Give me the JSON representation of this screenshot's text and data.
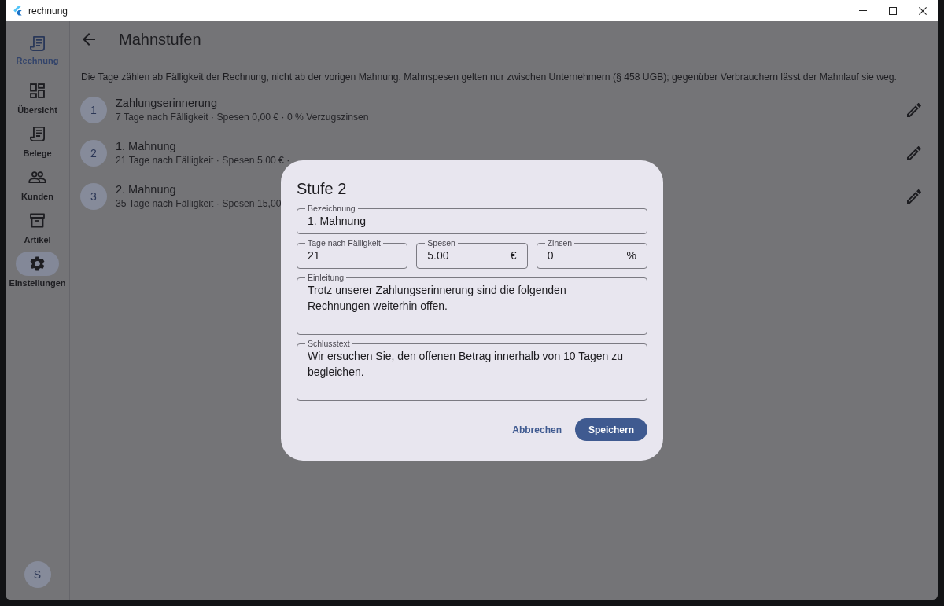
{
  "window": {
    "title": "rechnung"
  },
  "nav_rail": {
    "brand": "Rechnung",
    "items": [
      {
        "label": "Übersicht",
        "kind": "overview",
        "selected": false
      },
      {
        "label": "Belege",
        "kind": "documents",
        "selected": false
      },
      {
        "label": "Kunden",
        "kind": "customers",
        "selected": false
      },
      {
        "label": "Artikel",
        "kind": "articles",
        "selected": false
      },
      {
        "label": "Einstellungen",
        "kind": "settings",
        "selected": true
      }
    ],
    "avatar": "S"
  },
  "page": {
    "title": "Mahnstufen",
    "note": "Die Tage zählen ab Fälligkeit der Rechnung, nicht ab der vorigen Mahnung. Mahnspesen gelten nur zwischen Unternehmern (§ 458 UGB); gegenüber Verbrauchern lässt der Mahnlauf sie weg.",
    "levels": [
      {
        "number": "1",
        "title": "Zahlungserinnerung",
        "detail": "7 Tage nach Fälligkeit · Spesen 0,00 € · 0 % Verzugszinsen"
      },
      {
        "number": "2",
        "title": "1. Mahnung",
        "detail": "21 Tage nach Fälligkeit · Spesen 5,00 € ·"
      },
      {
        "number": "3",
        "title": "2. Mahnung",
        "detail": "35 Tage nach Fälligkeit · Spesen 15,00"
      }
    ]
  },
  "dialog": {
    "title": "Stufe 2",
    "rows": [
      [
        {
          "label": "Bezeichnung",
          "value": "1. Mahnung",
          "kind": "single"
        }
      ],
      [
        {
          "label": "Tage nach Fälligkeit",
          "value": "21",
          "kind": "single"
        },
        {
          "label": "Spesen",
          "value": "5.00",
          "suffix": "€",
          "kind": "single"
        },
        {
          "label": "Zinsen",
          "value": "0",
          "suffix": "%",
          "kind": "single"
        }
      ],
      [
        {
          "label": "Einleitung",
          "value": "Trotz unserer Zahlungserinnerung sind die folgenden Rechnungen weiterhin offen.",
          "kind": "multiline"
        }
      ],
      [
        {
          "label": "Schlusstext",
          "value": "Wir ersuchen Sie, den offenen Betrag innerhalb von 10 Tagen zu begleichen.",
          "kind": "multiline"
        }
      ]
    ],
    "buttons": [
      {
        "label": "Abbrechen",
        "kind": "text"
      },
      {
        "label": "Speichern",
        "kind": "filled"
      }
    ]
  }
}
